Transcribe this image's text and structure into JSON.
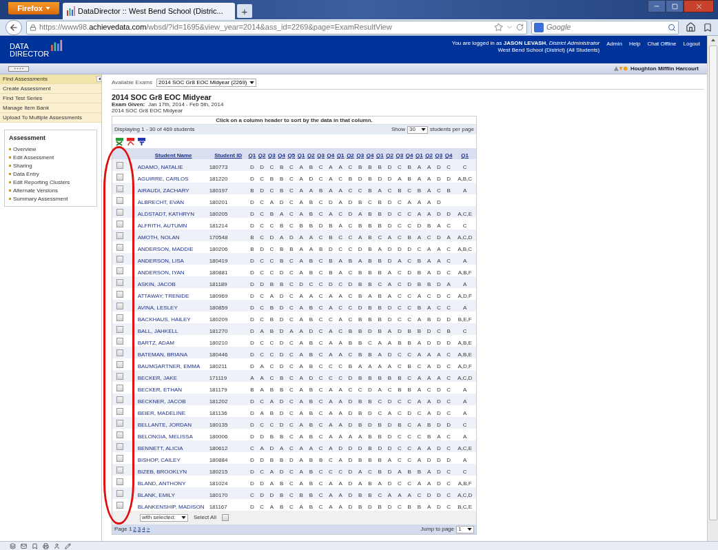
{
  "browser": {
    "menu_button": "Firefox",
    "tab_title": "DataDirector :: West Bend School (Distric...",
    "new_tab": "+",
    "url": "https://www98.**achievedata.com**/wbsd/?id=1695&view_year=2014&ass_id=2269&page=ExamResultView",
    "search_placeholder": "Google"
  },
  "header": {
    "logo_line1": "DATA",
    "logo_line2": "DIRECTOR",
    "login_text": "You are logged in as **JASON LEVASH**, *District Administrator*",
    "school": "West Bend School (District) (All Students)",
    "links": [
      "Admin",
      "Help",
      "Chat Offline",
      "Logout"
    ],
    "brand": "Houghton Mifflin Harcourt"
  },
  "sidebar": {
    "items": [
      {
        "label": "Find Assessments",
        "selected": true
      },
      {
        "label": "Create Assessment",
        "selected": false
      },
      {
        "label": "Find Test Series",
        "selected": false
      },
      {
        "label": "Manage Item Bank",
        "selected": false
      },
      {
        "label": "Upload To Multiple Assessments",
        "selected": false
      }
    ],
    "panel": {
      "title": "Assessment",
      "links": [
        "Overview",
        "Edit Assessment",
        "Sharing",
        "Data Entry",
        "Edit Reporting Clusters",
        "Alternate Versions",
        "Summary Assessment"
      ]
    }
  },
  "exam_selector": {
    "label": "Available Exams",
    "value": "2014 SOC Gr8 EOC Midyear (2269)"
  },
  "exam": {
    "title": "2014 SOC Gr8 EOC Midyear",
    "given": "**Exam Given:**  Jan 17th, 2014 - Feb 5th, 2014",
    "subtitle": "2014 SOC Gr8 EOC Midyear"
  },
  "table": {
    "instruction": "Click on a column header to sort by the data in that column.",
    "displaying": "Displaying 1 - 30 of 469 students",
    "show_label": "Show",
    "per_page": "30",
    "per_page_suffix": "students per page",
    "columns": [
      "Student Name",
      "Student ID",
      "Q1",
      "Q2",
      "Q3",
      "Q4",
      "Q5",
      "Q1",
      "Q2",
      "Q3",
      "Q4",
      "Q1",
      "Q2",
      "Q3",
      "Q4",
      "Q1",
      "Q2",
      "Q3",
      "Q4",
      "Q1",
      "Q2",
      "Q3",
      "Q4",
      "Q1"
    ],
    "rows": [
      {
        "checked": false,
        "name": "ADAMO, NATALIE",
        "id": "180773",
        "answers": [
          "D",
          "D",
          "C",
          "B",
          "C",
          "A",
          "B",
          "C",
          "A",
          "A",
          "C",
          "B",
          "B",
          "B",
          "D",
          "C",
          "B",
          "A",
          "A",
          "D",
          "C",
          "C"
        ]
      },
      {
        "checked": false,
        "name": "AGUIRRE, CARLOS",
        "id": "181220",
        "answers": [
          "D",
          "C",
          "B",
          "B",
          "C",
          "A",
          "D",
          "C",
          "A",
          "C",
          "B",
          "D",
          "B",
          "D",
          "D",
          "A",
          "B",
          "A",
          "A",
          "D",
          "D",
          "A,B,C"
        ]
      },
      {
        "checked": false,
        "name": "AIRAUDI, ZACHARY",
        "id": "180197",
        "answers": [
          "B",
          "D",
          "C",
          "B",
          "C",
          "A",
          "A",
          "B",
          "A",
          "A",
          "C",
          "C",
          "B",
          "A",
          "C",
          "B",
          "C",
          "B",
          "A",
          "C",
          "B",
          "A"
        ]
      },
      {
        "checked": false,
        "name": "ALBRECHT, EVAN",
        "id": "180201",
        "answers": [
          "D",
          "C",
          "A",
          "D",
          "C",
          "A",
          "B",
          "C",
          "D",
          "A",
          "D",
          "B",
          "C",
          "B",
          "D",
          "C",
          "A",
          "A",
          "A",
          "D"
        ]
      },
      {
        "checked": false,
        "name": "ALDSTADT, KATHRYN",
        "id": "180205",
        "answers": [
          "D",
          "C",
          "B",
          "A",
          "C",
          "A",
          "B",
          "C",
          "A",
          "C",
          "D",
          "A",
          "B",
          "B",
          "D",
          "C",
          "C",
          "A",
          "A",
          "D",
          "D",
          "A,C,E"
        ]
      },
      {
        "checked": false,
        "name": "ALFRITH, AUTUMN",
        "id": "181214",
        "answers": [
          "D",
          "C",
          "C",
          "B",
          "C",
          "B",
          "B",
          "D",
          "B",
          "A",
          "C",
          "B",
          "B",
          "B",
          "D",
          "C",
          "C",
          "D",
          "B",
          "A",
          "C",
          "C"
        ]
      },
      {
        "checked": false,
        "name": "AMOTH, NOLAN",
        "id": "170548",
        "answers": [
          "B",
          "C",
          "D",
          "A",
          "D",
          "A",
          "A",
          "C",
          "B",
          "C",
          "C",
          "A",
          "B",
          "C",
          "A",
          "C",
          "B",
          "A",
          "C",
          "D",
          "A",
          "A,C,D"
        ]
      },
      {
        "checked": false,
        "name": "ANDERSON, MADDIE",
        "id": "180206",
        "answers": [
          "B",
          "D",
          "C",
          "B",
          "B",
          "A",
          "A",
          "B",
          "D",
          "C",
          "C",
          "D",
          "B",
          "A",
          "D",
          "D",
          "D",
          "C",
          "A",
          "A",
          "C",
          "A,B,C"
        ]
      },
      {
        "checked": false,
        "name": "ANDERSON, LISA",
        "id": "180419",
        "answers": [
          "D",
          "C",
          "C",
          "B",
          "C",
          "A",
          "B",
          "C",
          "B",
          "A",
          "B",
          "A",
          "B",
          "B",
          "D",
          "A",
          "C",
          "B",
          "A",
          "A",
          "C",
          "A"
        ]
      },
      {
        "checked": false,
        "name": "ANDERSON, IYAN",
        "id": "180881",
        "answers": [
          "D",
          "C",
          "C",
          "D",
          "C",
          "A",
          "B",
          "C",
          "B",
          "A",
          "C",
          "B",
          "B",
          "B",
          "A",
          "C",
          "D",
          "B",
          "A",
          "D",
          "C",
          "A,B,F"
        ]
      },
      {
        "checked": false,
        "name": "ASKIN, JACOB",
        "id": "181189",
        "answers": [
          "D",
          "D",
          "B",
          "B",
          "C",
          "D",
          "C",
          "C",
          "D",
          "C",
          "D",
          "B",
          "B",
          "C",
          "A",
          "C",
          "D",
          "B",
          "B",
          "D",
          "A",
          "A"
        ]
      },
      {
        "checked": false,
        "name": "ATTAWAY, TRENIDE",
        "id": "180969",
        "answers": [
          "D",
          "C",
          "A",
          "D",
          "C",
          "A",
          "A",
          "C",
          "A",
          "A",
          "C",
          "B",
          "A",
          "B",
          "A",
          "C",
          "C",
          "A",
          "C",
          "D",
          "C",
          "A,D,F"
        ]
      },
      {
        "checked": false,
        "name": "AVINA, LESLEY",
        "id": "180859",
        "answers": [
          "D",
          "C",
          "B",
          "D",
          "C",
          "A",
          "B",
          "C",
          "A",
          "C",
          "C",
          "D",
          "B",
          "B",
          "D",
          "C",
          "C",
          "B",
          "A",
          "C",
          "C",
          "A"
        ]
      },
      {
        "checked": false,
        "name": "BACKHAUS, HAILEY",
        "id": "180209",
        "answers": [
          "D",
          "C",
          "B",
          "D",
          "C",
          "A",
          "B",
          "C",
          "C",
          "A",
          "C",
          "B",
          "B",
          "B",
          "D",
          "C",
          "C",
          "A",
          "B",
          "D",
          "D",
          "B,E,F"
        ]
      },
      {
        "checked": false,
        "name": "BALL, JAHKELL",
        "id": "181270",
        "answers": [
          "D",
          "A",
          "B",
          "D",
          "A",
          "A",
          "D",
          "C",
          "A",
          "C",
          "B",
          "B",
          "D",
          "B",
          "A",
          "D",
          "B",
          "B",
          "D",
          "C",
          "B",
          "C"
        ]
      },
      {
        "checked": false,
        "name": "BARTZ, ADAM",
        "id": "180210",
        "answers": [
          "D",
          "C",
          "C",
          "D",
          "C",
          "A",
          "B",
          "C",
          "A",
          "A",
          "B",
          "B",
          "C",
          "A",
          "A",
          "B",
          "B",
          "A",
          "D",
          "D",
          "D",
          "A,B,E"
        ]
      },
      {
        "checked": false,
        "name": "BATEMAN, BRIANA",
        "id": "180446",
        "answers": [
          "D",
          "C",
          "C",
          "D",
          "C",
          "A",
          "B",
          "C",
          "A",
          "A",
          "C",
          "B",
          "B",
          "A",
          "D",
          "C",
          "C",
          "A",
          "A",
          "A",
          "C",
          "A,B,E"
        ]
      },
      {
        "checked": false,
        "name": "BAUMGARTNER, EMMA",
        "id": "180211",
        "answers": [
          "D",
          "A",
          "C",
          "D",
          "C",
          "A",
          "B",
          "C",
          "C",
          "C",
          "B",
          "A",
          "A",
          "A",
          "A",
          "C",
          "B",
          "C",
          "A",
          "D",
          "C",
          "A,D,F"
        ]
      },
      {
        "checked": false,
        "name": "BECKER, JAKE",
        "id": "171119",
        "answers": [
          "A",
          "A",
          "C",
          "B",
          "C",
          "A",
          "D",
          "C",
          "C",
          "C",
          "D",
          "B",
          "B",
          "B",
          "B",
          "B",
          "C",
          "A",
          "A",
          "A",
          "C",
          "A,C,D"
        ]
      },
      {
        "checked": false,
        "name": "BECKER, ETHAN",
        "id": "181179",
        "answers": [
          "B",
          "A",
          "B",
          "B",
          "C",
          "A",
          "B",
          "C",
          "A",
          "A",
          "C",
          "C",
          "D",
          "A",
          "C",
          "B",
          "B",
          "A",
          "C",
          "D",
          "C",
          "A"
        ]
      },
      {
        "checked": false,
        "name": "BECKNER, JACOB",
        "id": "181202",
        "answers": [
          "D",
          "C",
          "A",
          "D",
          "C",
          "A",
          "B",
          "C",
          "A",
          "A",
          "D",
          "B",
          "B",
          "C",
          "D",
          "C",
          "C",
          "A",
          "A",
          "D",
          "C",
          "A"
        ]
      },
      {
        "checked": false,
        "name": "BEIER, MADELINE",
        "id": "181136",
        "answers": [
          "D",
          "A",
          "B",
          "D",
          "C",
          "A",
          "B",
          "C",
          "A",
          "A",
          "D",
          "B",
          "D",
          "C",
          "A",
          "C",
          "D",
          "C",
          "A",
          "D",
          "C",
          "A"
        ]
      },
      {
        "checked": false,
        "name": "BELLANTE, JORDAN",
        "id": "180135",
        "answers": [
          "D",
          "C",
          "C",
          "D",
          "C",
          "A",
          "B",
          "C",
          "A",
          "A",
          "D",
          "B",
          "D",
          "B",
          "D",
          "B",
          "C",
          "A",
          "B",
          "D",
          "D",
          "C"
        ]
      },
      {
        "checked": false,
        "name": "BELONGIA, MELISSA",
        "id": "180006",
        "answers": [
          "D",
          "D",
          "B",
          "B",
          "C",
          "A",
          "B",
          "C",
          "A",
          "A",
          "A",
          "A",
          "B",
          "B",
          "D",
          "C",
          "C",
          "C",
          "B",
          "A",
          "C",
          "A"
        ]
      },
      {
        "checked": false,
        "name": "BENNETT, ALICIA",
        "id": "180612",
        "answers": [
          "C",
          "A",
          "D",
          "A",
          "C",
          "A",
          "A",
          "C",
          "A",
          "D",
          "D",
          "D",
          "B",
          "D",
          "D",
          "C",
          "C",
          "A",
          "A",
          "D",
          "C",
          "A,C,E"
        ]
      },
      {
        "checked": false,
        "name": "BISHOP, CAILEY",
        "id": "180884",
        "answers": [
          "D",
          "D",
          "B",
          "B",
          "D",
          "A",
          "B",
          "B",
          "C",
          "A",
          "D",
          "B",
          "B",
          "B",
          "A",
          "C",
          "C",
          "A",
          "D",
          "D",
          "D",
          "A"
        ]
      },
      {
        "checked": false,
        "name": "BIZEB, BROOKLYN",
        "id": "180215",
        "answers": [
          "D",
          "C",
          "A",
          "D",
          "C",
          "A",
          "B",
          "C",
          "C",
          "C",
          "D",
          "A",
          "C",
          "B",
          "D",
          "A",
          "B",
          "B",
          "A",
          "D",
          "C",
          "C"
        ]
      },
      {
        "checked": false,
        "name": "BLAND, ANTHONY",
        "id": "181024",
        "answers": [
          "D",
          "D",
          "A",
          "B",
          "C",
          "A",
          "B",
          "C",
          "A",
          "A",
          "D",
          "A",
          "B",
          "A",
          "D",
          "C",
          "C",
          "A",
          "A",
          "D",
          "C",
          "A,B,F"
        ]
      },
      {
        "checked": false,
        "name": "BLANK, EMILY",
        "id": "180170",
        "answers": [
          "C",
          "D",
          "D",
          "B",
          "C",
          "B",
          "B",
          "C",
          "A",
          "A",
          "D",
          "B",
          "B",
          "C",
          "A",
          "A",
          "A",
          "C",
          "D",
          "D",
          "C",
          "A,C,D"
        ]
      },
      {
        "checked": false,
        "name": "BLANKENSHIP, MADISON",
        "id": "181167",
        "answers": [
          "D",
          "C",
          "A",
          "B",
          "C",
          "A",
          "B",
          "C",
          "A",
          "A",
          "D",
          "B",
          "D",
          "B",
          "D",
          "C",
          "B",
          "B",
          "A",
          "D",
          "C",
          "B,C,E"
        ]
      }
    ],
    "with_selected": "with selected:",
    "select_all_label": "Select All",
    "select_all_checked": false,
    "page_label": "Page 1",
    "pages": [
      "2",
      "3",
      "4",
      ">"
    ],
    "jump_label": "Jump to page",
    "jump_value": "1"
  }
}
